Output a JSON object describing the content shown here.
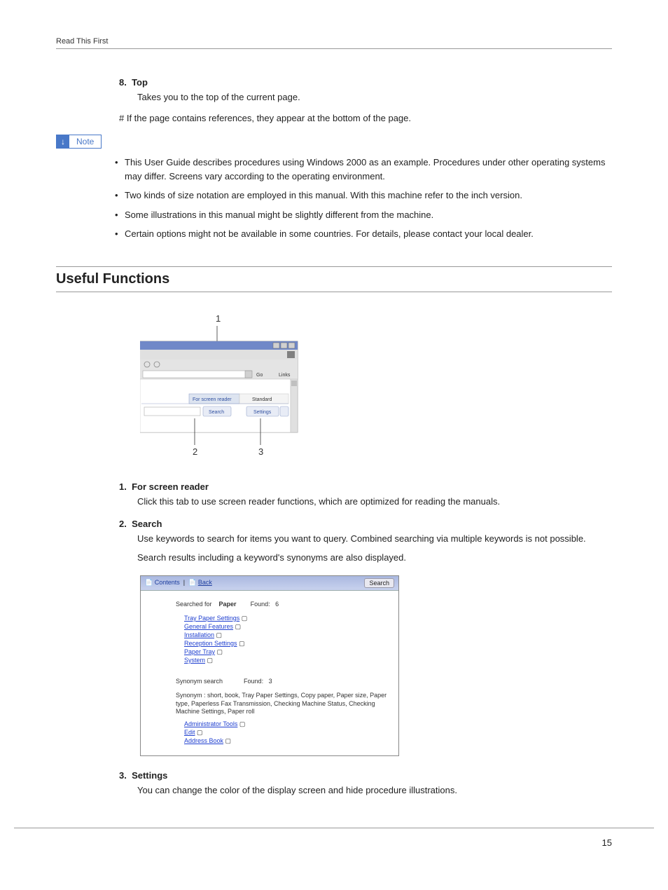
{
  "header": "Read This First",
  "item8": {
    "num": "8.",
    "title": "Top",
    "body": "Takes you to the top of the current page."
  },
  "hashNote": "# If the page contains references, they appear at the bottom of the page.",
  "noteLabel": "Note",
  "notes": [
    "This User Guide describes procedures using Windows 2000 as an example. Procedures under other operating systems may differ. Screens vary according to the operating environment.",
    "Two kinds of size notation are employed in this manual. With this machine refer to the inch version.",
    "Some illustrations in this manual might be slightly different from the machine.",
    "Certain options might not be available in some countries. For details, please contact your local dealer."
  ],
  "sectionTitle": "Useful Functions",
  "fig1": {
    "callout1": "1",
    "callout2": "2",
    "callout3": "3",
    "tabScreenReader": "For screen reader",
    "tabStandard": "Standard",
    "btnSearch": "Search",
    "btnSettings": "Settings",
    "goLabel": "Go",
    "linksLabel": "Links"
  },
  "ol": {
    "i1": {
      "num": "1.",
      "title": "For screen reader",
      "body": "Click this tab to use screen reader functions, which are optimized for reading the manuals."
    },
    "i2": {
      "num": "2.",
      "title": "Search",
      "body1": "Use keywords to search for items you want to query. Combined searching via multiple keywords is not possible.",
      "body2": "Search results including a keyword's synonyms are also displayed."
    },
    "i3": {
      "num": "3.",
      "title": "Settings",
      "body": "You can change the color of the display screen and hide procedure illustrations."
    }
  },
  "searchFig": {
    "contents": "Contents",
    "back": "Back",
    "searchBtn": "Search",
    "searchedFor": "Searched for",
    "keyword": "Paper",
    "foundLabel": "Found:",
    "found1": "6",
    "results1": [
      "Tray Paper Settings",
      "General Features",
      "Installation",
      "Reception Settings",
      "Paper Tray",
      "System"
    ],
    "synonymSearch": "Synonym search",
    "found2": "3",
    "synText": "Synonym : short, book, Tray Paper Settings, Copy paper, Paper size, Paper type, Paperless Fax Transmission, Checking Machine Status, Checking Machine Settings, Paper roll",
    "results2": [
      "Administrator Tools",
      "Edit",
      "Address Book"
    ]
  },
  "pageNumber": "15"
}
